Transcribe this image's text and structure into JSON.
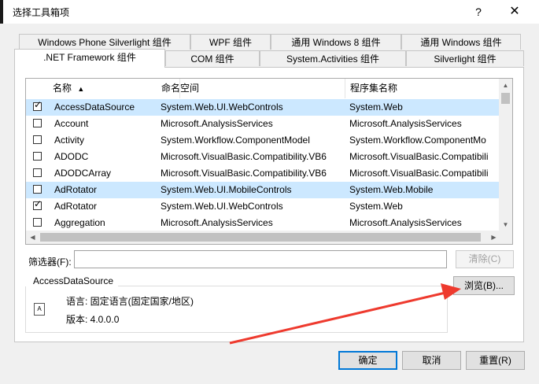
{
  "dialog": {
    "title": "选择工具箱项",
    "help": "?",
    "close": "✕"
  },
  "tabs_row1": [
    "Windows Phone Silverlight 组件",
    "WPF 组件",
    "通用 Windows 8 组件",
    "通用 Windows 组件"
  ],
  "tabs_row2": [
    ".NET Framework 组件",
    "COM 组件",
    "System.Activities 组件",
    "Silverlight 组件"
  ],
  "list": {
    "columns": [
      "名称",
      "命名空间",
      "程序集名称"
    ],
    "sort_indicator": "▲",
    "rows": [
      {
        "checked": true,
        "name": "AccessDataSource",
        "namespace": "System.Web.UI.WebControls",
        "assembly": "System.Web",
        "selected": true
      },
      {
        "checked": false,
        "name": "Account",
        "namespace": "Microsoft.AnalysisServices",
        "assembly": "Microsoft.AnalysisServices",
        "selected": false
      },
      {
        "checked": false,
        "name": "Activity",
        "namespace": "System.Workflow.ComponentModel",
        "assembly": "System.Workflow.ComponentMo",
        "selected": false
      },
      {
        "checked": false,
        "name": "ADODC",
        "namespace": "Microsoft.VisualBasic.Compatibility.VB6",
        "assembly": "Microsoft.VisualBasic.Compatibili",
        "selected": false
      },
      {
        "checked": false,
        "name": "ADODCArray",
        "namespace": "Microsoft.VisualBasic.Compatibility.VB6",
        "assembly": "Microsoft.VisualBasic.Compatibili",
        "selected": false
      },
      {
        "checked": false,
        "name": "AdRotator",
        "namespace": "System.Web.UI.MobileControls",
        "assembly": "System.Web.Mobile",
        "selected": true
      },
      {
        "checked": true,
        "name": "AdRotator",
        "namespace": "System.Web.UI.WebControls",
        "assembly": "System.Web",
        "selected": false
      },
      {
        "checked": false,
        "name": "Aggregation",
        "namespace": "Microsoft.AnalysisServices",
        "assembly": "Microsoft.AnalysisServices",
        "selected": false
      }
    ]
  },
  "filter": {
    "label": "筛选器(F):",
    "value": "",
    "clear_label": "清除(C)"
  },
  "details": {
    "title": "AccessDataSource",
    "language": "语言: 固定语言(固定国家/地区)",
    "version": "版本: 4.0.0.0",
    "browse_label": "浏览(B)..."
  },
  "footer": {
    "ok_label": "确定",
    "cancel_label": "取消",
    "reset_label": "重置(R)"
  },
  "colors": {
    "selection": "#cce8ff",
    "annotation_arrow": "#ee3a2e",
    "default_button_border": "#0078d7"
  }
}
